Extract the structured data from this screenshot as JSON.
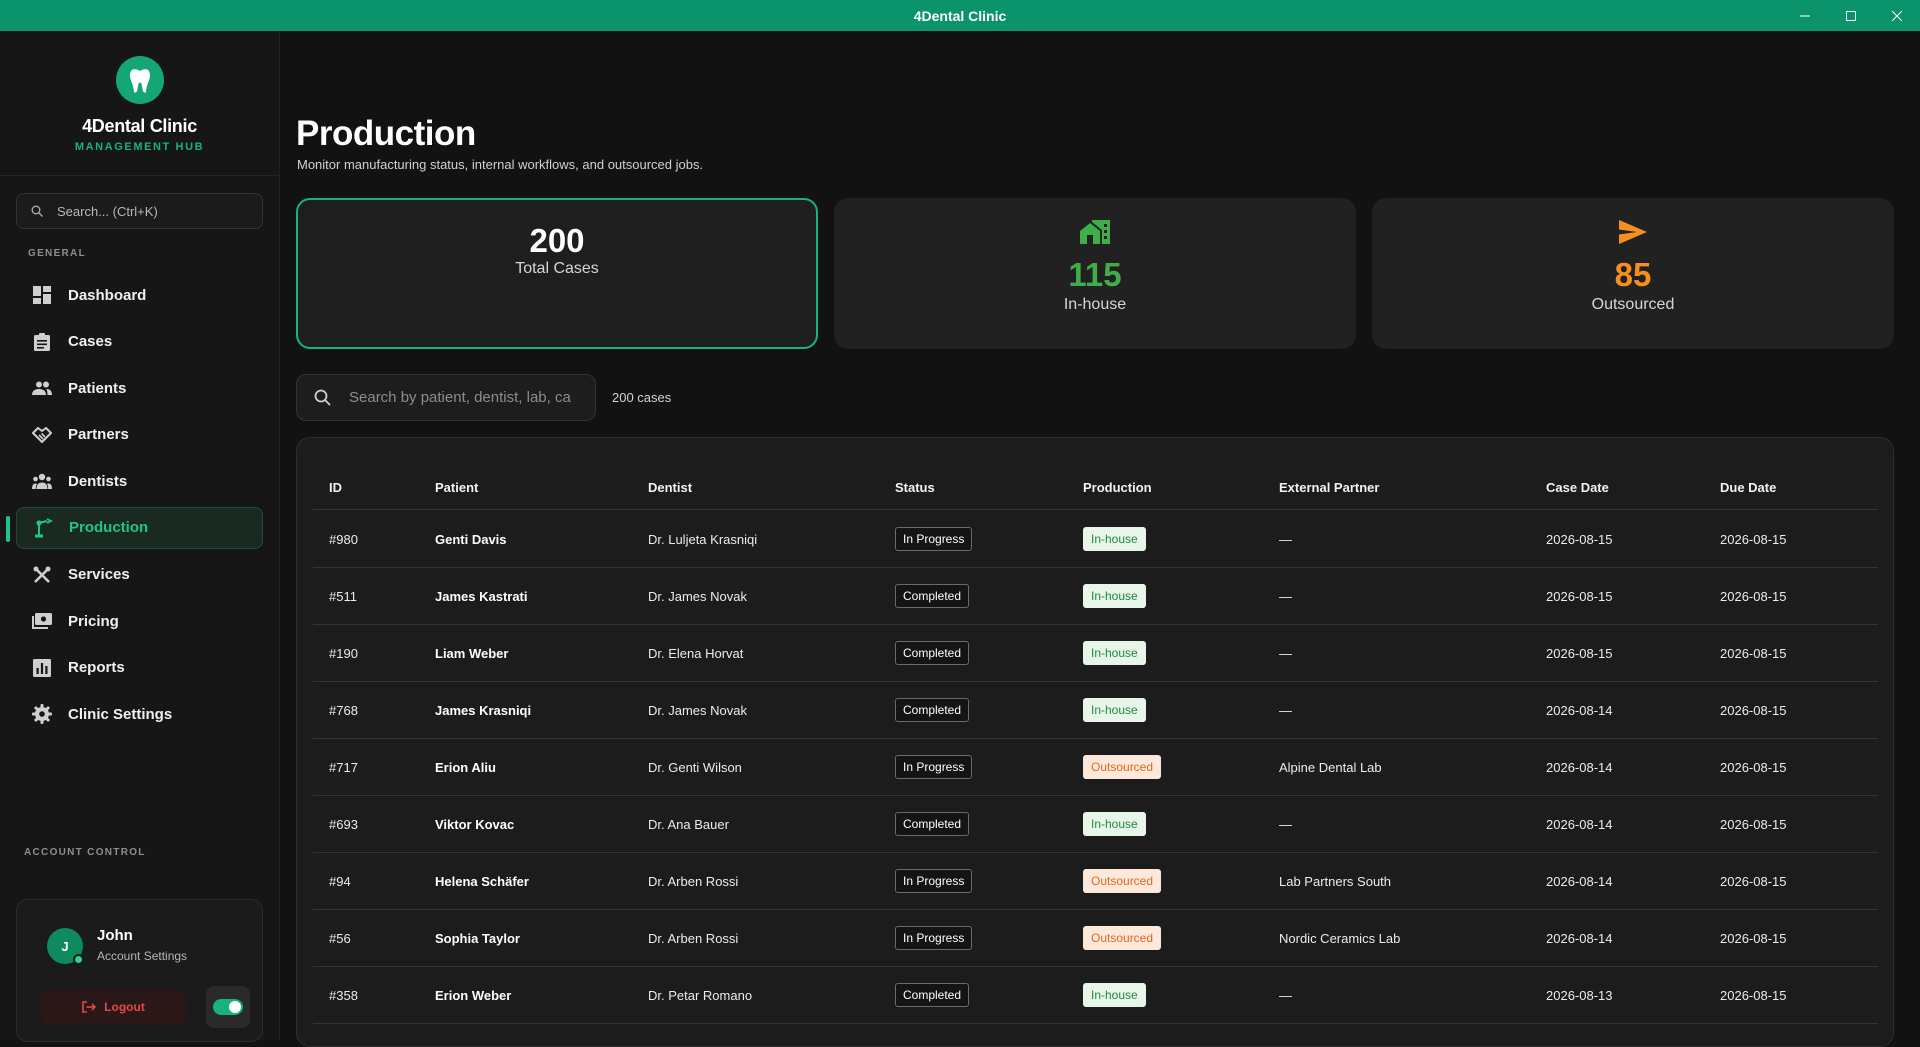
{
  "window": {
    "title": "4Dental Clinic"
  },
  "brand": {
    "name": "4Dental Clinic",
    "subtitle": "MANAGEMENT HUB"
  },
  "sidebar": {
    "search_placeholder": "Search... (Ctrl+K)",
    "general_label": "GENERAL",
    "items": [
      {
        "label": "Dashboard",
        "icon": "dashboard-icon"
      },
      {
        "label": "Cases",
        "icon": "clipboard-icon"
      },
      {
        "label": "Patients",
        "icon": "people-icon"
      },
      {
        "label": "Partners",
        "icon": "handshake-icon"
      },
      {
        "label": "Dentists",
        "icon": "group-icon"
      },
      {
        "label": "Production",
        "icon": "precision-manufacturing-icon",
        "active": true
      },
      {
        "label": "Services",
        "icon": "tools-icon"
      },
      {
        "label": "Pricing",
        "icon": "payments-icon"
      },
      {
        "label": "Reports",
        "icon": "bar-chart-icon"
      },
      {
        "label": "Clinic Settings",
        "icon": "gear-icon"
      }
    ],
    "account_label": "ACCOUNT CONTROL",
    "account": {
      "initial": "J",
      "name": "John",
      "sub": "Account Settings",
      "logout": "Logout",
      "theme_toggle_on": true
    }
  },
  "page": {
    "title": "Production",
    "subtitle": "Monitor manufacturing status, internal workflows, and outsourced jobs."
  },
  "stats": {
    "total": {
      "value": "200",
      "label": "Total Cases"
    },
    "inhouse": {
      "value": "115",
      "label": "In-house",
      "color": "#3fae4a"
    },
    "outsourced": {
      "value": "85",
      "label": "Outsourced",
      "color": "#f5901e"
    }
  },
  "table": {
    "search_placeholder": "Search by patient, dentist, lab, ca",
    "count_label": "200 cases",
    "columns": [
      "ID",
      "Patient",
      "Dentist",
      "Status",
      "Production",
      "External Partner",
      "Case Date",
      "Due Date"
    ],
    "rows": [
      {
        "id": "#980",
        "patient": "Genti Davis",
        "dentist": "Dr. Luljeta Krasniqi",
        "status": "In Progress",
        "production": "In-house",
        "partner": "—",
        "case_date": "2026-08-15",
        "due_date": "2026-08-15"
      },
      {
        "id": "#511",
        "patient": "James Kastrati",
        "dentist": "Dr. James Novak",
        "status": "Completed",
        "production": "In-house",
        "partner": "—",
        "case_date": "2026-08-15",
        "due_date": "2026-08-15"
      },
      {
        "id": "#190",
        "patient": "Liam Weber",
        "dentist": "Dr. Elena Horvat",
        "status": "Completed",
        "production": "In-house",
        "partner": "—",
        "case_date": "2026-08-15",
        "due_date": "2026-08-15"
      },
      {
        "id": "#768",
        "patient": "James Krasniqi",
        "dentist": "Dr. James Novak",
        "status": "Completed",
        "production": "In-house",
        "partner": "—",
        "case_date": "2026-08-14",
        "due_date": "2026-08-15"
      },
      {
        "id": "#717",
        "patient": "Erion Aliu",
        "dentist": "Dr. Genti Wilson",
        "status": "In Progress",
        "production": "Outsourced",
        "partner": "Alpine Dental Lab",
        "case_date": "2026-08-14",
        "due_date": "2026-08-15"
      },
      {
        "id": "#693",
        "patient": "Viktor Kovac",
        "dentist": "Dr. Ana Bauer",
        "status": "Completed",
        "production": "In-house",
        "partner": "—",
        "case_date": "2026-08-14",
        "due_date": "2026-08-15"
      },
      {
        "id": "#94",
        "patient": "Helena Schäfer",
        "dentist": "Dr. Arben Rossi",
        "status": "In Progress",
        "production": "Outsourced",
        "partner": "Lab Partners South",
        "case_date": "2026-08-14",
        "due_date": "2026-08-15"
      },
      {
        "id": "#56",
        "patient": "Sophia Taylor",
        "dentist": "Dr. Arben Rossi",
        "status": "In Progress",
        "production": "Outsourced",
        "partner": "Nordic Ceramics Lab",
        "case_date": "2026-08-14",
        "due_date": "2026-08-15"
      },
      {
        "id": "#358",
        "patient": "Erion Weber",
        "dentist": "Dr. Petar Romano",
        "status": "Completed",
        "production": "In-house",
        "partner": "—",
        "case_date": "2026-08-13",
        "due_date": "2026-08-15"
      }
    ]
  },
  "colors": {
    "accent": "#0b946b",
    "inhouse_badge_text": "#1e8b3d",
    "outsourced_badge_text": "#e0681b"
  }
}
